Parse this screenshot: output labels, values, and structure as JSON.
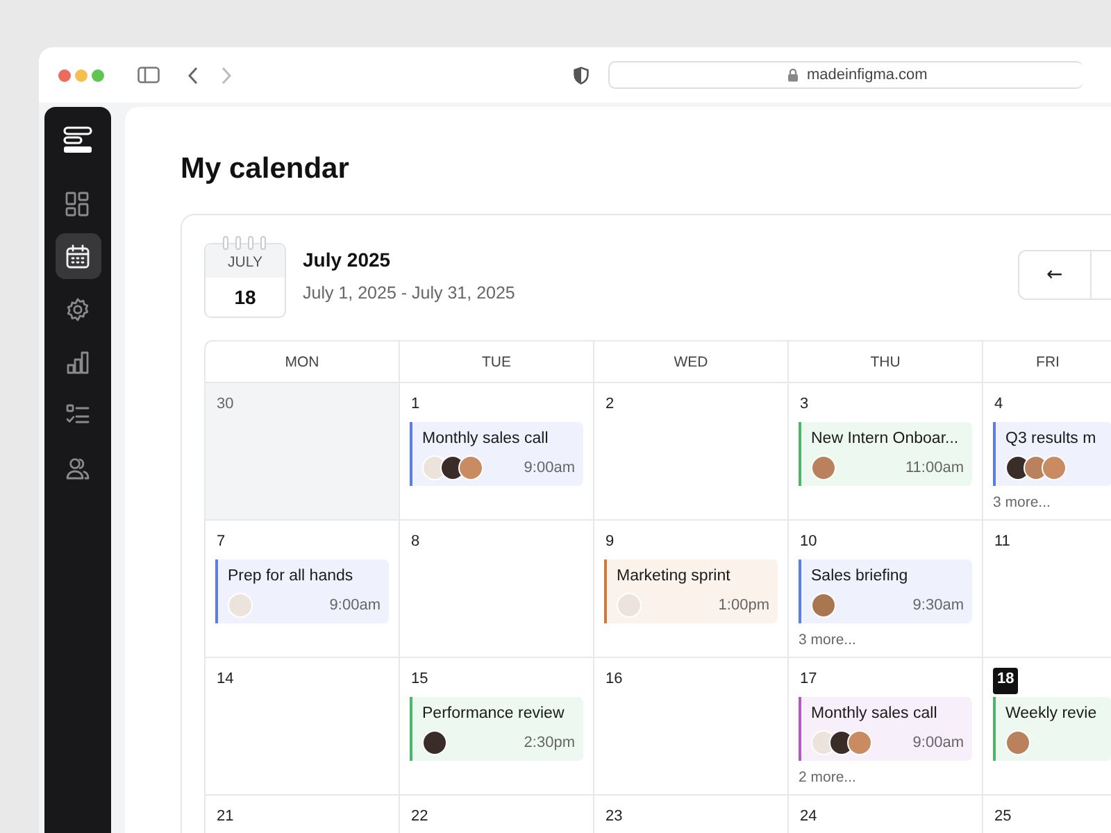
{
  "browser": {
    "url": "madeinfigma.com"
  },
  "sidebar": {
    "items": [
      {
        "kind": "dashboard",
        "selected": false
      },
      {
        "kind": "calendar",
        "selected": true
      },
      {
        "kind": "settings",
        "selected": false
      },
      {
        "kind": "chart",
        "selected": false
      },
      {
        "kind": "checklist",
        "selected": false
      },
      {
        "kind": "users",
        "selected": false
      }
    ]
  },
  "page_title": "My calendar",
  "calendar": {
    "badge_month": "JULY",
    "badge_day": "18",
    "title": "July 2025",
    "range": "July 1, 2025 - July 31, 2025",
    "prev_button": "←",
    "weekdays": [
      "MON",
      "TUE",
      "WED",
      "THU",
      "FRI"
    ],
    "weeks": [
      {
        "days": [
          {
            "date": "30",
            "outside": true,
            "today": false
          },
          {
            "date": "1",
            "outside": false,
            "today": false,
            "events": [
              {
                "title": "Monthly sales call",
                "time": "9:00am",
                "color": "#5b7fe0",
                "avatars": [
                  {
                    "color": "#ece4dc"
                  },
                  {
                    "color": "#3a2d28"
                  },
                  {
                    "color": "#c98b62"
                  }
                ]
              }
            ]
          },
          {
            "date": "2",
            "outside": false,
            "today": false
          },
          {
            "date": "3",
            "outside": false,
            "today": false,
            "events": [
              {
                "title": "New Intern Onboar...",
                "time": "11:00am",
                "color": "#4cb56a",
                "avatars": [
                  {
                    "color": "#b9825c"
                  }
                ]
              }
            ]
          },
          {
            "date": "4",
            "outside": false,
            "today": false,
            "events": [
              {
                "title": "Q3 results m",
                "color": "#5b7fe0",
                "avatars": [
                  {
                    "color": "#3a2d28"
                  },
                  {
                    "color": "#b9825c"
                  },
                  {
                    "color": "#c98b62"
                  }
                ]
              }
            ],
            "more": "3 more..."
          }
        ]
      },
      {
        "days": [
          {
            "date": "7",
            "outside": false,
            "today": false,
            "events": [
              {
                "title": "Prep for all hands",
                "time": "9:00am",
                "color": "#5b7fe0",
                "avatars": [
                  {
                    "color": "#ece4dc"
                  }
                ]
              }
            ]
          },
          {
            "date": "8",
            "outside": false,
            "today": false
          },
          {
            "date": "9",
            "outside": false,
            "today": false,
            "events": [
              {
                "title": "Marketing sprint",
                "time": "1:00pm",
                "color": "#d0793a",
                "avatars": [
                  {
                    "color": "#ece4dc"
                  }
                ]
              }
            ]
          },
          {
            "date": "10",
            "outside": false,
            "today": false,
            "events": [
              {
                "title": "Sales briefing",
                "time": "9:30am",
                "color": "#5b7fe0",
                "avatars": [
                  {
                    "color": "#a8774f"
                  }
                ]
              }
            ],
            "more": "3 more..."
          },
          {
            "date": "11",
            "outside": false,
            "today": false
          }
        ]
      },
      {
        "days": [
          {
            "date": "14",
            "outside": false,
            "today": false
          },
          {
            "date": "15",
            "outside": false,
            "today": false,
            "events": [
              {
                "title": "Performance review",
                "time": "2:30pm",
                "color": "#4cb56a",
                "avatars": [
                  {
                    "color": "#3a2d28"
                  }
                ]
              }
            ]
          },
          {
            "date": "16",
            "outside": false,
            "today": false
          },
          {
            "date": "17",
            "outside": false,
            "today": false,
            "events": [
              {
                "title": "Monthly sales call",
                "time": "9:00am",
                "color": "#b05bc0",
                "avatars": [
                  {
                    "color": "#ece4dc"
                  },
                  {
                    "color": "#3a2d28"
                  },
                  {
                    "color": "#c98b62"
                  }
                ]
              }
            ],
            "more": "2 more..."
          },
          {
            "date": "18",
            "outside": false,
            "today": true,
            "events": [
              {
                "title": "Weekly revie",
                "color": "#4cb56a",
                "avatars": [
                  {
                    "color": "#b9825c"
                  }
                ]
              }
            ]
          }
        ]
      },
      {
        "days": [
          {
            "date": "21",
            "outside": false,
            "today": false
          },
          {
            "date": "22",
            "outside": false,
            "today": false
          },
          {
            "date": "23",
            "outside": false,
            "today": false
          },
          {
            "date": "24",
            "outside": false,
            "today": false
          },
          {
            "date": "25",
            "outside": false,
            "today": false
          }
        ]
      }
    ]
  }
}
